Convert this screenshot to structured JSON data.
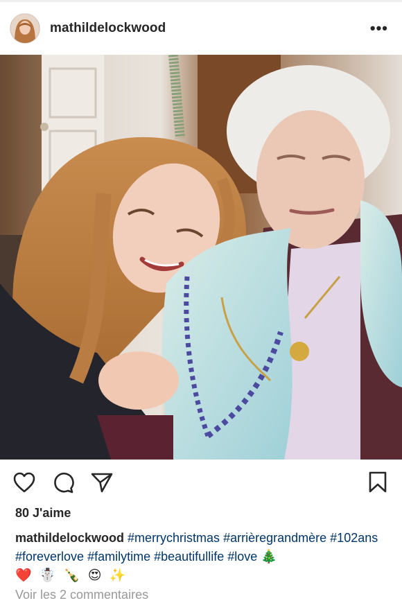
{
  "post": {
    "username": "mathildelockwood",
    "more_icon": "more-horizontal-icon",
    "photo_description_icon": "photo",
    "actions": {
      "like_icon": "heart-icon",
      "comment_icon": "comment-icon",
      "share_icon": "paper-plane-icon",
      "save_icon": "bookmark-icon"
    },
    "likes_text": "80 J'aime",
    "caption": {
      "username": "mathildelockwood",
      "hashtags": [
        "#merrychristmas",
        "#arrièregrandmère",
        "#102ans",
        "#foreverlove",
        "#familytime",
        "#beautifullife",
        "#love"
      ],
      "emojis_line1": "🎄",
      "emojis_line2": "❤️ ☃️ 🍾 😍 ✨"
    },
    "view_comments": "Voir les 2 commentaires"
  },
  "colors": {
    "text": "#262626",
    "hashtag": "#003569",
    "muted": "#999999",
    "divider": "#efefef"
  }
}
